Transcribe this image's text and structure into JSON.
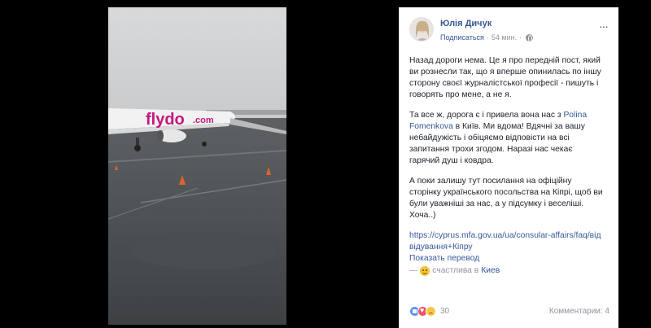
{
  "post": {
    "author": "Юлія Дичук",
    "follow_label": "Подписаться",
    "separator": "·",
    "time": "54 мин.",
    "menu": "···",
    "paragraphs": {
      "p1": "Назад дороги нема. Це я про передній пост, який ви рознесли так, що я вперше опинилась по іншу сторону своєї журналістської професії - пишуть і говорять про мене, а не я.",
      "p2_before": "Та все ж, дорога є і привела вона нас з ",
      "p2_link": "Polina Fomenkova",
      "p2_after": " в Київ. Ми вдома! Вдячні за вашу небайдужість і обіцяємо відповісти на всі запитання трохи згодом. Наразі нас чекає гарячий душ і ковдра.",
      "p3": "А поки залишу тут посилання на офіційну сторінку українського посольства на Кіпрі, щоб ви були уважніші за нас, а у підсумку і веселіші. Хоча..)",
      "url": "https://cyprus.mfa.gov.ua/ua/consular-affairs/faq/відвідування+Кіпру"
    },
    "translate_label": "Показать перевод",
    "feeling_dash": "—",
    "feeling_text": "счастлива в",
    "feeling_place": "Киев",
    "reactions_count": "30",
    "comments_label": "Комментарии: 4"
  },
  "photo": {
    "logo_text": "flydo.com",
    "brand_color": "#c5177f"
  },
  "colors": {
    "link": "#365899",
    "muted": "#90949c",
    "text": "#1d2129"
  }
}
